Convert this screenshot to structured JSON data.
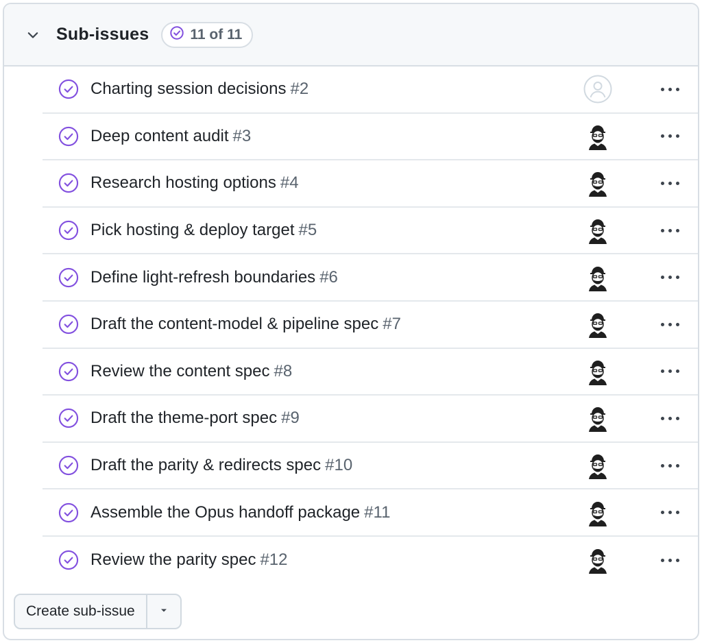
{
  "header": {
    "title": "Sub-issues",
    "counter_icon": "check-circle-icon",
    "counter_text": "11 of 11",
    "collapse_icon": "chevron-down-icon"
  },
  "colors": {
    "done_purple": "#8250df",
    "muted": "#59636e",
    "border": "#d8dee4",
    "header_bg": "#f6f8fa"
  },
  "issues": [
    {
      "title": "Charting session decisions",
      "number": "#2",
      "assignee": "none"
    },
    {
      "title": "Deep content audit",
      "number": "#3",
      "assignee": "avatar"
    },
    {
      "title": "Research hosting options",
      "number": "#4",
      "assignee": "avatar"
    },
    {
      "title": "Pick hosting & deploy target",
      "number": "#5",
      "assignee": "avatar"
    },
    {
      "title": "Define light-refresh boundaries",
      "number": "#6",
      "assignee": "avatar"
    },
    {
      "title": "Draft the content-model & pipeline spec",
      "number": "#7",
      "assignee": "avatar"
    },
    {
      "title": "Review the content spec",
      "number": "#8",
      "assignee": "avatar"
    },
    {
      "title": "Draft the theme-port spec",
      "number": "#9",
      "assignee": "avatar"
    },
    {
      "title": "Draft the parity & redirects spec",
      "number": "#10",
      "assignee": "avatar"
    },
    {
      "title": "Assemble the Opus handoff package",
      "number": "#11",
      "assignee": "avatar"
    },
    {
      "title": "Review the parity spec",
      "number": "#12",
      "assignee": "avatar"
    }
  ],
  "footer": {
    "create_label": "Create sub-issue",
    "dropdown_icon": "caret-down-icon"
  }
}
